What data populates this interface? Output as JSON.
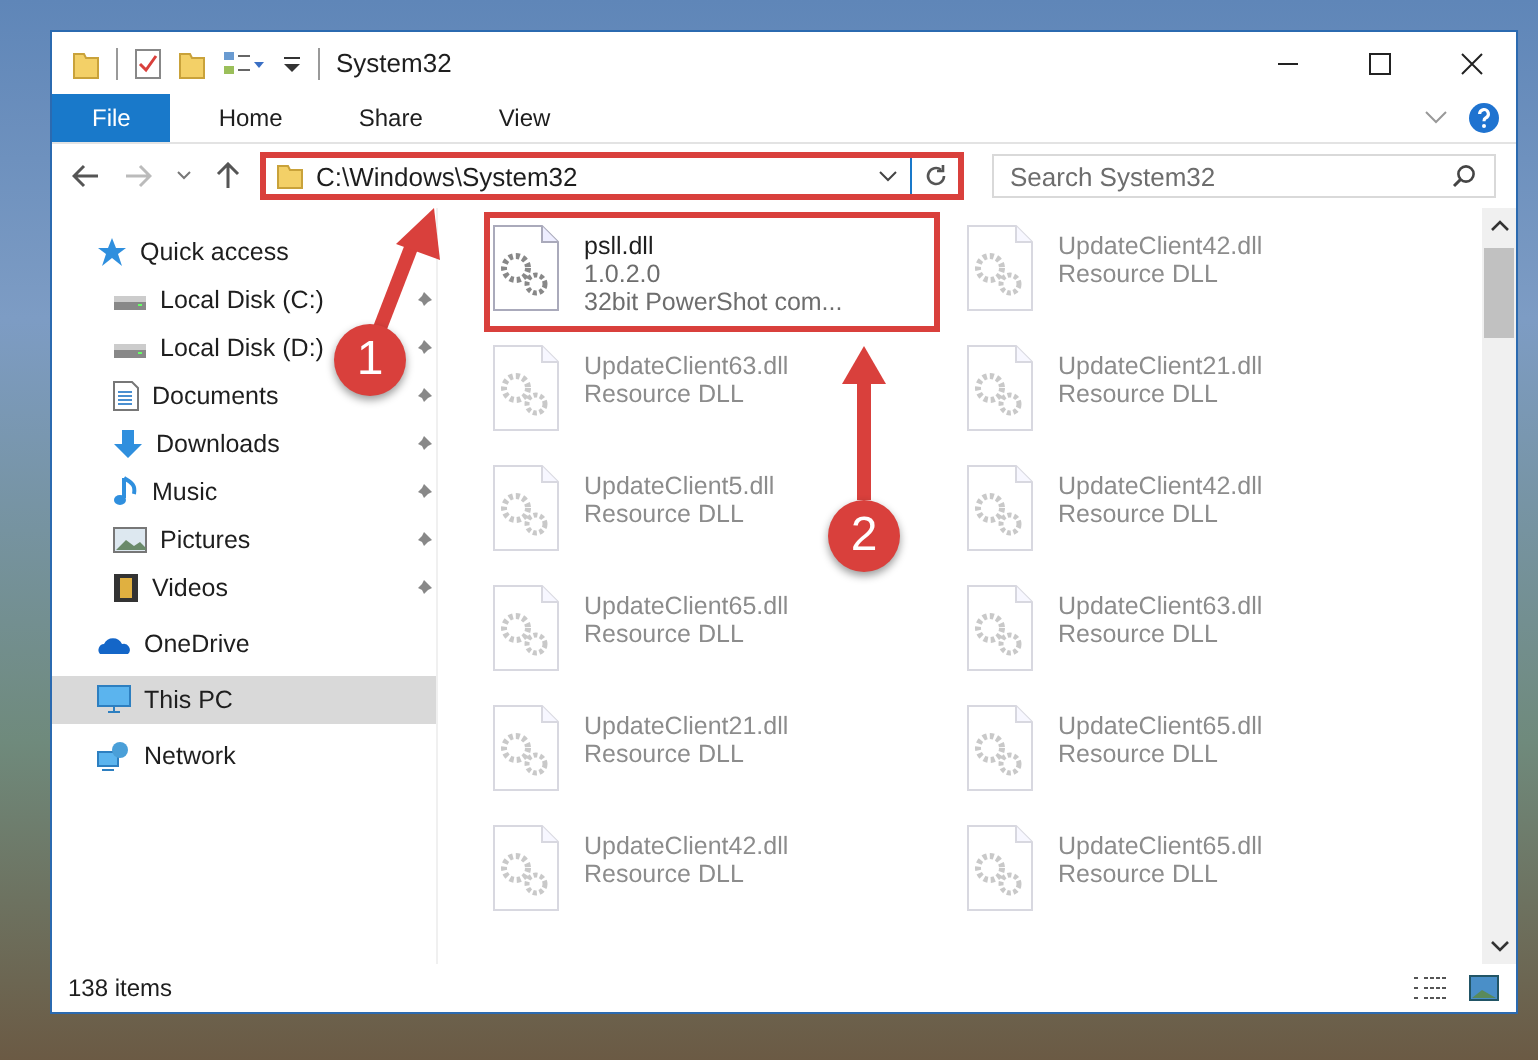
{
  "window": {
    "title": "System32"
  },
  "ribbon_tabs": [
    {
      "label": "File",
      "kind": "file"
    },
    {
      "label": "Home",
      "kind": "tab"
    },
    {
      "label": "Share",
      "kind": "tab"
    },
    {
      "label": "View",
      "kind": "tab"
    }
  ],
  "address_bar": {
    "path": "C:\\Windows\\System32"
  },
  "search": {
    "placeholder": "Search System32"
  },
  "nav_pane": {
    "items": [
      {
        "label": "Quick access",
        "kind": "star",
        "selected": false,
        "children": [
          {
            "label": "Local Disk (C:)",
            "kind": "drive",
            "pinned": true,
            "selected": false
          },
          {
            "label": "Local Disk (D:)",
            "kind": "drive",
            "pinned": true,
            "selected": false
          },
          {
            "label": "Documents",
            "kind": "documents",
            "pinned": true,
            "selected": false
          },
          {
            "label": "Downloads",
            "kind": "downloads",
            "pinned": true,
            "selected": false
          },
          {
            "label": "Music",
            "kind": "music",
            "pinned": true,
            "selected": false
          },
          {
            "label": "Pictures",
            "kind": "pictures",
            "pinned": true,
            "selected": false
          },
          {
            "label": "Videos",
            "kind": "videos",
            "pinned": true,
            "selected": false
          }
        ]
      },
      {
        "label": "OneDrive",
        "kind": "cloud",
        "selected": false
      },
      {
        "label": "This PC",
        "kind": "pc",
        "selected": true
      },
      {
        "label": "Network",
        "kind": "network",
        "selected": false
      }
    ]
  },
  "files": [
    {
      "lines": [
        "psll.dll",
        "1.0.2.0",
        "32bit PowerShot com..."
      ],
      "faded": false,
      "highlighted": true
    },
    {
      "lines": [
        "UpdateClient42.dll",
        "Resource DLL"
      ],
      "faded": true,
      "highlighted": false
    },
    {
      "lines": [
        "UpdateClient63.dll",
        "Resource DLL"
      ],
      "faded": true,
      "highlighted": false
    },
    {
      "lines": [
        "UpdateClient21.dll",
        "Resource DLL"
      ],
      "faded": true,
      "highlighted": false
    },
    {
      "lines": [
        "UpdateClient5.dll",
        "Resource DLL"
      ],
      "faded": true,
      "highlighted": false
    },
    {
      "lines": [
        "UpdateClient42.dll",
        "Resource DLL"
      ],
      "faded": true,
      "highlighted": false
    },
    {
      "lines": [
        "UpdateClient65.dll",
        "Resource DLL"
      ],
      "faded": true,
      "highlighted": false
    },
    {
      "lines": [
        "UpdateClient63.dll",
        "Resource DLL"
      ],
      "faded": true,
      "highlighted": false
    },
    {
      "lines": [
        "UpdateClient21.dll",
        "Resource DLL"
      ],
      "faded": true,
      "highlighted": false
    },
    {
      "lines": [
        "UpdateClient65.dll",
        "Resource DLL"
      ],
      "faded": true,
      "highlighted": false
    },
    {
      "lines": [
        "UpdateClient42.dll",
        "Resource DLL"
      ],
      "faded": true,
      "highlighted": false
    },
    {
      "lines": [
        "UpdateClient65.dll",
        "Resource DLL"
      ],
      "faded": true,
      "highlighted": false
    }
  ],
  "status_bar": {
    "item_count": "138 items"
  },
  "annotations": [
    {
      "number": "1"
    },
    {
      "number": "2"
    }
  ]
}
